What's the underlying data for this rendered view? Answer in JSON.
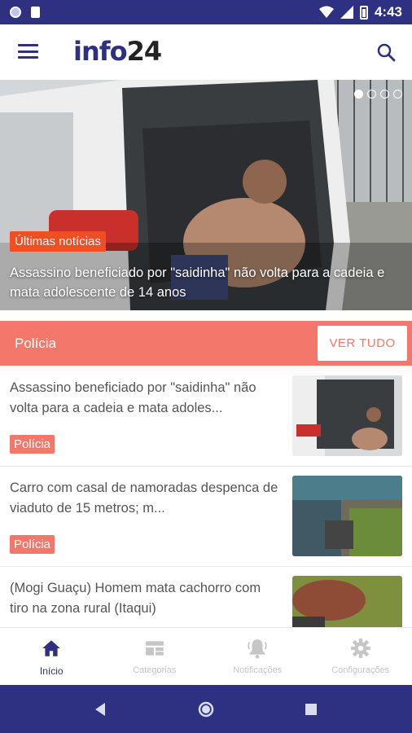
{
  "status_bar": {
    "time": "4:43"
  },
  "app_bar": {
    "logo_text": "info",
    "logo_number": "24"
  },
  "hero": {
    "badge": "Últimas notícias",
    "title": "Assassino beneficiado por \"saidinha\" não volta para a cadeia e mata adolescente de 14 anos",
    "slides_total": 4,
    "active_slide": 1
  },
  "section": {
    "title": "Polícia",
    "button_label": "VER TUDO"
  },
  "news": [
    {
      "title": "Assassino beneficiado por \"saidinha\" não volta para a cadeia e mata adoles...",
      "tag": "Polícia"
    },
    {
      "title": "Carro com casal de namoradas despenca de viaduto de 15 metros; m...",
      "tag": "Polícia"
    },
    {
      "title": "(Mogi Guaçu) Homem mata cachorro com tiro na zona rural (Itaqui)",
      "tag": ""
    }
  ],
  "bottom_nav": [
    {
      "label": "Início",
      "icon": "home-icon",
      "active": true
    },
    {
      "label": "Categorias",
      "icon": "grid-icon",
      "active": false
    },
    {
      "label": "Notificações",
      "icon": "bell-icon",
      "active": false
    },
    {
      "label": "Configurações",
      "icon": "gear-icon",
      "active": false
    }
  ],
  "colors": {
    "primary": "#2e3182",
    "accent": "#f3776a",
    "badge": "#f04e23"
  }
}
